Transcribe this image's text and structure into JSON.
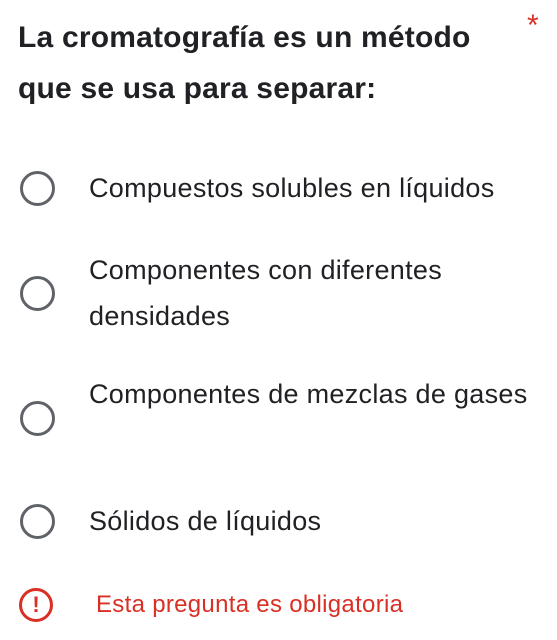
{
  "question": {
    "title": "La cromatografía es un método que se usa para separar:",
    "required_marker": "*",
    "options": [
      {
        "label": "Compuestos solubles en líquidos",
        "selected": false
      },
      {
        "label": "Componentes con diferentes densidades",
        "selected": false
      },
      {
        "label": "Componentes de mezclas de gases",
        "selected": false
      },
      {
        "label": "Sólidos de líquidos",
        "selected": false
      }
    ],
    "error_icon": "!",
    "error_message": "Esta pregunta es obligatoria"
  },
  "colors": {
    "text": "#202124",
    "radio_border": "#5f6368",
    "error": "#d93025"
  },
  "icons": {
    "radio": "radio-unchecked-icon",
    "error": "error-exclamation-icon"
  }
}
